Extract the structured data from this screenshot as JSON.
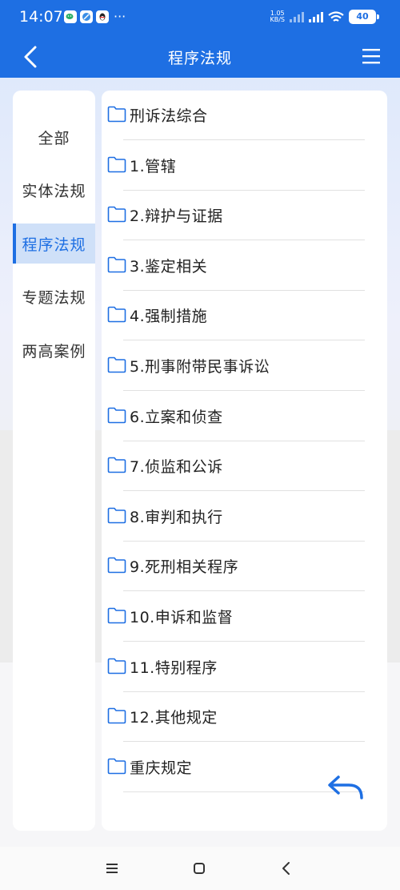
{
  "status_bar": {
    "time": "14:07",
    "dots": "···",
    "net_speed_value": "1.05",
    "net_speed_unit": "KB/S",
    "battery": "40"
  },
  "header": {
    "title": "程序法规"
  },
  "sidebar": {
    "items": [
      {
        "label": "全部",
        "active": false
      },
      {
        "label": "实体法规",
        "active": false
      },
      {
        "label": "程序法规",
        "active": true
      },
      {
        "label": "专题法规",
        "active": false
      },
      {
        "label": "两高案例",
        "active": false
      }
    ]
  },
  "folders": [
    "刑诉法综合",
    "1.管辖",
    "2.辩护与证据",
    "3.鉴定相关",
    "4.强制措施",
    "5.刑事附带民事诉讼",
    "6.立案和侦查",
    "7.侦监和公诉",
    "8.审判和执行",
    "9.死刑相关程序",
    "10.申诉和监督",
    "11.特别程序",
    "12.其他规定",
    "重庆规定"
  ],
  "colors": {
    "accent": "#1e6fe3",
    "active_bg": "#cfe0f8",
    "folder_icon": "#1e6fe3"
  },
  "icons": {
    "back": "chevron-left-icon",
    "menu": "hamburger-menu-icon",
    "folder": "folder-icon",
    "return": "return-arrow-icon"
  }
}
